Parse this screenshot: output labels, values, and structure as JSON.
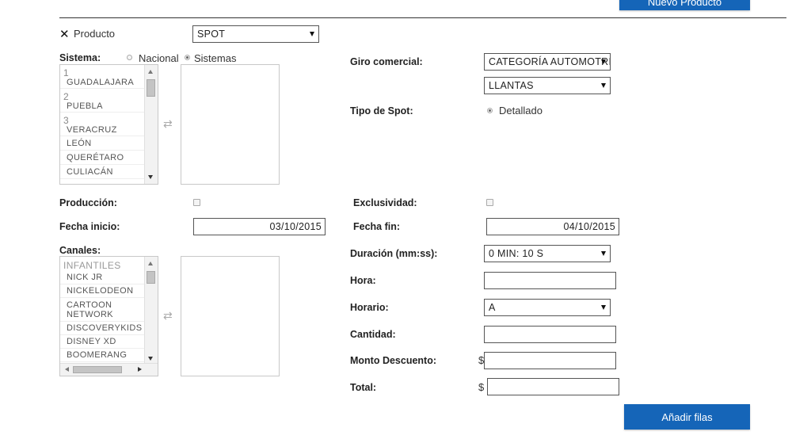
{
  "header": {
    "new_product_label": "Nuevo Producto"
  },
  "producto": {
    "close_symbol": "✕",
    "label": "Producto",
    "selected": "SPOT"
  },
  "sistema": {
    "label": "Sistema:",
    "radio_nacional": "Nacional",
    "radio_sistemas": "Sistemas",
    "selected_radio": "Sistemas",
    "options": [
      {
        "num": "1",
        "name": "GUADALAJARA"
      },
      {
        "num": "2",
        "name": "PUEBLA"
      },
      {
        "num": "3",
        "name": "VERACRUZ"
      },
      {
        "num": "",
        "name": "LEÓN"
      },
      {
        "num": "",
        "name": "QUERÉTARO"
      },
      {
        "num": "",
        "name": "CULIACÁN"
      }
    ]
  },
  "giro": {
    "label": "Giro comercial:",
    "category": "CATEGORÍA AUTOMOTRIZ",
    "subcategory": "LLANTAS"
  },
  "tipo_spot": {
    "label": "Tipo de Spot:",
    "option": "Detallado"
  },
  "produccion": {
    "label": "Producción:",
    "checked": false
  },
  "exclusividad": {
    "label": "Exclusividad:",
    "checked": false
  },
  "fecha_inicio": {
    "label": "Fecha inicio:",
    "value": "03/10/2015"
  },
  "fecha_fin": {
    "label": "Fecha fin:",
    "value": "04/10/2015"
  },
  "canales": {
    "label": "Canales:",
    "group": "INFANTILES",
    "options": [
      "NICK JR",
      "NICKELODEON",
      "CARTOON NETWORK",
      "DISCOVERYKIDS",
      "DISNEY XD",
      "BOOMERANG"
    ]
  },
  "duracion": {
    "label": "Duración (mm:ss):",
    "selected": "0 MIN: 10 S"
  },
  "hora": {
    "label": "Hora:",
    "value": ""
  },
  "horario": {
    "label": "Horario:",
    "selected": "A"
  },
  "cantidad": {
    "label": "Cantidad:",
    "value": ""
  },
  "monto_descuento": {
    "label": "Monto Descuento:",
    "currency": "$",
    "value": ""
  },
  "total": {
    "label": "Total:",
    "currency": "$",
    "value": ""
  },
  "footer": {
    "add_rows_label": "Añadir filas"
  }
}
